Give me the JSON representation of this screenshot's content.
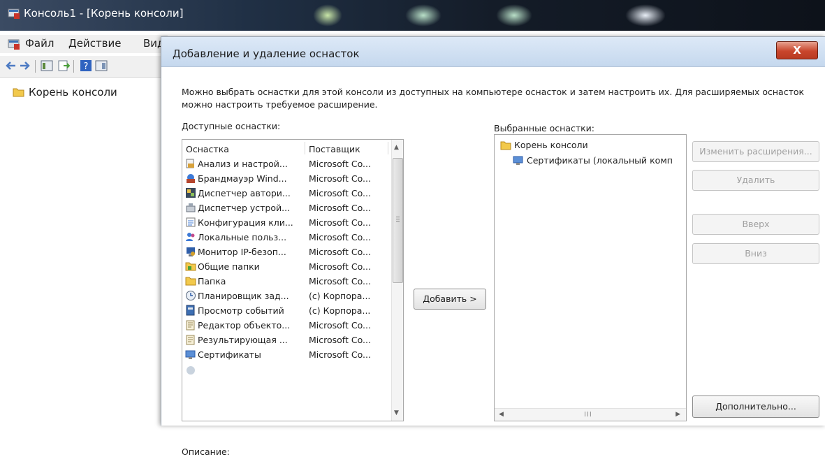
{
  "console": {
    "title": "Консоль1 - [Корень консоли]",
    "menu": [
      "Файл",
      "Действие",
      "Вид"
    ],
    "tree_root": "Корень консоли"
  },
  "dialog": {
    "title": "Добавление и удаление оснасток",
    "close_glyph": "X",
    "intro": "Можно выбрать оснастки для этой консоли из доступных на компьютере оснасток и затем настроить их. Для расширяемых оснасток можно настроить требуемое расширение.",
    "available_label": "Доступные оснастки:",
    "selected_label": "Выбранные оснастки:",
    "columns": {
      "snapin": "Оснастка",
      "vendor": "Поставщик"
    },
    "available": [
      {
        "name": "Анализ и настрой...",
        "vendor": "Microsoft Co...",
        "icon": "analysis-icon"
      },
      {
        "name": "Брандмауэр Wind...",
        "vendor": "Microsoft Co...",
        "icon": "firewall-icon"
      },
      {
        "name": "Диспетчер автори...",
        "vendor": "Microsoft Co...",
        "icon": "authorization-manager-icon"
      },
      {
        "name": "Диспетчер устрой...",
        "vendor": "Microsoft Co...",
        "icon": "device-manager-icon"
      },
      {
        "name": "Конфигурация кли...",
        "vendor": "Microsoft Co...",
        "icon": "client-config-icon"
      },
      {
        "name": "Локальные польз...",
        "vendor": "Microsoft Co...",
        "icon": "local-users-icon"
      },
      {
        "name": "Монитор IP-безоп...",
        "vendor": "Microsoft Co...",
        "icon": "ip-security-monitor-icon"
      },
      {
        "name": "Общие папки",
        "vendor": "Microsoft Co...",
        "icon": "shared-folders-icon"
      },
      {
        "name": "Папка",
        "vendor": "Microsoft Co...",
        "icon": "folder-icon"
      },
      {
        "name": "Планировщик зад...",
        "vendor": "(c) Корпора...",
        "icon": "task-scheduler-icon"
      },
      {
        "name": "Просмотр событий",
        "vendor": "(c) Корпора...",
        "icon": "event-viewer-icon"
      },
      {
        "name": "Редактор объекто...",
        "vendor": "Microsoft Co...",
        "icon": "object-editor-icon"
      },
      {
        "name": "Результирующая ...",
        "vendor": "Microsoft Co...",
        "icon": "resultant-policy-icon"
      },
      {
        "name": "Сертификаты",
        "vendor": "Microsoft Co...",
        "icon": "certificates-icon"
      }
    ],
    "selected_root": "Корень консоли",
    "selected_child": "Сертификаты (локальный комп",
    "buttons": {
      "add": "Добавить >",
      "edit_ext": "Изменить расширения...",
      "remove": "Удалить",
      "up": "Вверх",
      "down": "Вниз",
      "advanced": "Дополнительно..."
    },
    "hscroll_grip": "III",
    "description_label": "Описание:"
  },
  "colors": {
    "dialog_bg": "#f0f0f0",
    "close_red": "#c9462c",
    "title_gradient": "#c5d8ee",
    "folder_yellow": "#f2c94c"
  }
}
